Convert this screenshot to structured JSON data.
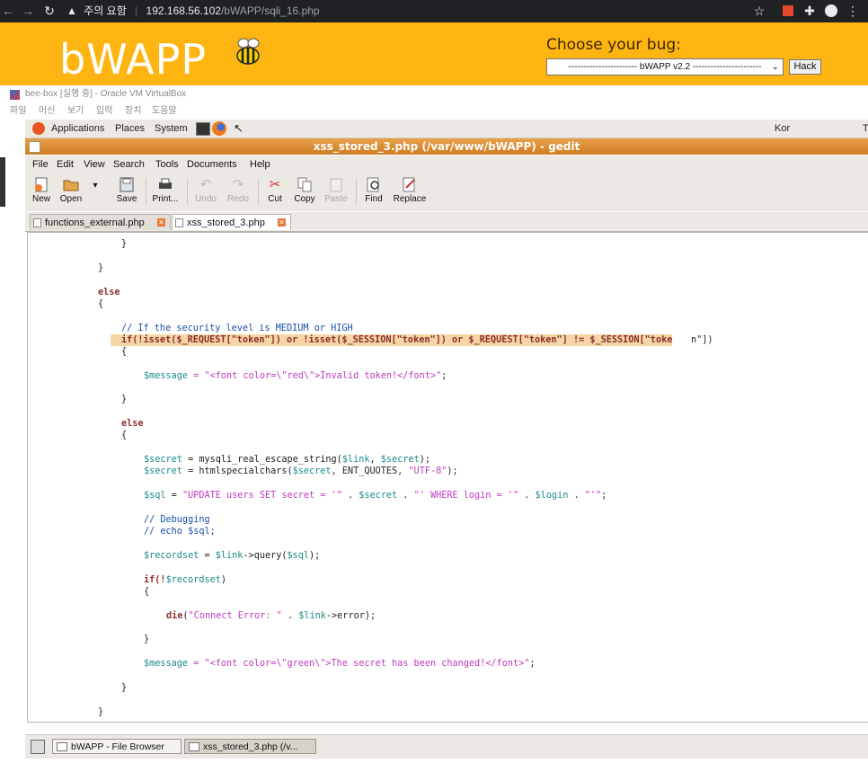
{
  "browser": {
    "security_label": "주의 요함",
    "url_host": "192.168.56.102",
    "url_path": "/bWAPP/sqli_16.php"
  },
  "bwapp": {
    "logo_text": "bWAPP",
    "choose_label": "Choose your bug:",
    "bug_select_value": "----------------------- bWAPP v2.2 -----------------------",
    "hack_button": "Hack"
  },
  "vbox": {
    "title": "bee-box [실행 중] - Oracle VM VirtualBox",
    "menu": [
      "파일",
      "머신",
      "보기",
      "입력",
      "장치",
      "도움말"
    ]
  },
  "gnome_panel": {
    "items": [
      "Applications",
      "Places",
      "System"
    ],
    "keyboard": "Kor",
    "clock_partial": "T"
  },
  "gedit": {
    "title": "xss_stored_3.php (/var/www/bWAPP) - gedit",
    "menu": [
      "File",
      "Edit",
      "View",
      "Search",
      "Tools",
      "Documents",
      "Help"
    ],
    "toolbar": {
      "new": "New",
      "open": "Open",
      "save": "Save",
      "print": "Print...",
      "undo": "Undo",
      "redo": "Redo",
      "cut": "Cut",
      "copy": "Copy",
      "paste": "Paste",
      "find": "Find",
      "replace": "Replace"
    },
    "tabs": [
      "functions_external.php",
      "xss_stored_3.php"
    ],
    "code": {
      "l1": "}",
      "l2": "}",
      "l3": "else",
      "l4": "{",
      "l5": "// If the security level is MEDIUM or HIGH",
      "l6a": "if(!isset($_REQUEST[\"token\"]) or !isset($_SESSION[\"token\"]) or $_REQUEST[\"token\"] != $_SESSION[\"toke",
      "l6b": "n\"])",
      "l7": "{",
      "l8a": "$message",
      "l8b": " = ",
      "l8c": "\"<font color=\\\"red\\\">Invalid token!</font>\"",
      "l8d": ";",
      "l9": "}",
      "l10": "else",
      "l11": "{",
      "l12a": "$secret",
      "l12b": " = mysqli_real_escape_string(",
      "l12c": "$link",
      "l12d": ", ",
      "l12e": "$secret",
      "l12f": ");",
      "l13a": "$secret",
      "l13b": " = htmlspecialchars(",
      "l13c": "$secret",
      "l13d": ", ENT_QUOTES, ",
      "l13e": "\"UTF-8\"",
      "l13f": ");",
      "l14a": "$sql",
      "l14b": " = ",
      "l14c": "\"UPDATE users SET secret = '\"",
      "l14d": " . ",
      "l14e": "$secret",
      "l14f": " . ",
      "l14g": "\"' WHERE login = '\"",
      "l14h": " . ",
      "l14i": "$login",
      "l14j": " . ",
      "l14k": "\"'\"",
      "l14l": ";",
      "l15": "// Debugging",
      "l16": "// echo $sql;",
      "l17a": "$recordset",
      "l17b": " = ",
      "l17c": "$link",
      "l17d": "->query(",
      "l17e": "$sql",
      "l17f": ");",
      "l18a": "if",
      "l18b": "(!",
      "l18c": "$recordset",
      "l18d": ")",
      "l19": "{",
      "l20a": "die",
      "l20b": "(",
      "l20c": "\"Connect Error: \"",
      "l20d": " . ",
      "l20e": "$link",
      "l20f": "->error);",
      "l21": "}",
      "l22a": "$message",
      "l22b": " = ",
      "l22c": "\"<font color=\\\"green\\\">The secret has been changed!</font>\"",
      "l22d": ";",
      "l23": "}",
      "l24": "}"
    }
  },
  "taskbar": {
    "items": [
      "bWAPP - File Browser",
      "xss_stored_3.php (/v..."
    ]
  }
}
